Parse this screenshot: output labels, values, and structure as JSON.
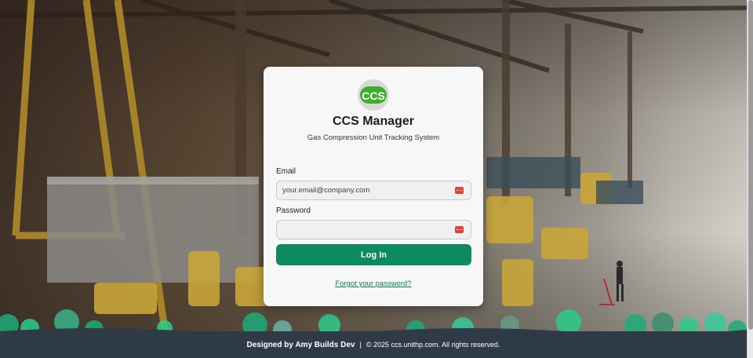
{
  "app": {
    "title": "CCS Manager",
    "subtitle": "Gas Compression Unit Tracking System",
    "logo_text": "CCS"
  },
  "form": {
    "email_label": "Email",
    "email_placeholder": "your.email@company.com",
    "email_value": "",
    "password_label": "Password",
    "password_placeholder": "",
    "password_value": "",
    "login_label": "Log In",
    "forgot_label": "Forgot your password?"
  },
  "footer": {
    "designed_by": "Designed by Amy Builds Dev",
    "separator": "|",
    "copyright": "© 2025 ccs.unithp.com. All rights reserved."
  },
  "icons": {
    "logo": "ccs-logo-icon",
    "password_manager": "password-manager-icon"
  },
  "colors": {
    "accent": "#0e8a60",
    "footer_bg": "#2e3b46",
    "card_bg": "#f7f7f7",
    "pw_icon": "#d9453a",
    "logo_green": "#3fae2a"
  }
}
